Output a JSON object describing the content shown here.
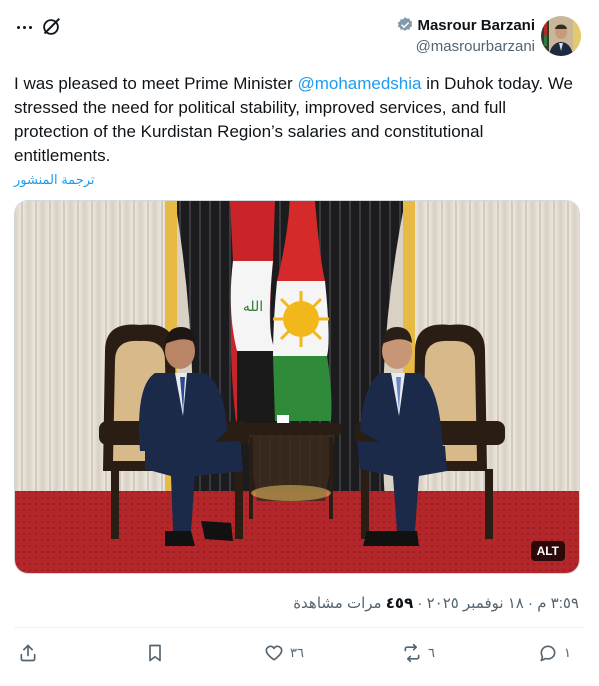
{
  "author": {
    "name": "Masrour Barzani",
    "handle": "@masrourbarzani"
  },
  "tweet": {
    "text_before": "I was pleased to meet Prime Minister ",
    "mention": "@mohamedshia",
    "text_after": " in Duhok today. We stressed the need for political stability, improved services, and full protection of the Kurdistan Region’s salaries and constitutional entitlements.",
    "translate_label": "ترجمة المنشور"
  },
  "media": {
    "alt_label": "ALT"
  },
  "meta": {
    "time": "٣:٥٩ م",
    "separator": "·",
    "date": "١٨ نوفمبر ٢٠٢٥",
    "views_label": "مرات مشاهدة",
    "views_count": "٤٥٩"
  },
  "actions": {
    "replies": "١",
    "reposts": "٦",
    "likes": "٣٦"
  },
  "colors": {
    "accent": "#1d9bf0",
    "text": "#0f1419",
    "muted": "#536471"
  },
  "icons": [
    "more-icon",
    "grok-icon",
    "verified-icon",
    "share-icon",
    "bookmark-icon",
    "like-icon",
    "repost-icon",
    "reply-icon"
  ]
}
